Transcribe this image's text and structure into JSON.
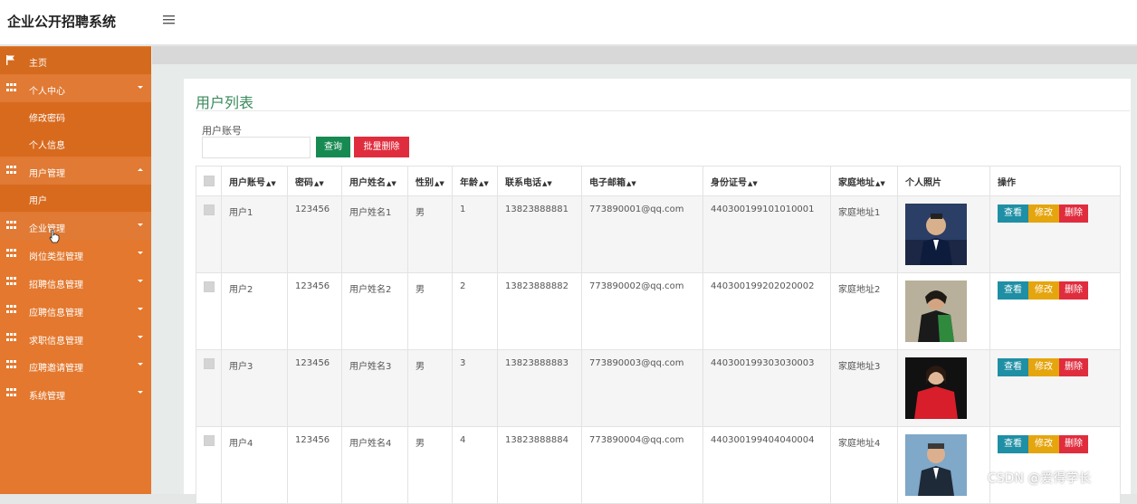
{
  "app": {
    "title": "企业公开招聘系统"
  },
  "sidebar": {
    "items": [
      {
        "label": "主页"
      },
      {
        "label": "个人中心"
      },
      {
        "label": "修改密码"
      },
      {
        "label": "个人信息"
      },
      {
        "label": "用户管理"
      },
      {
        "label": "用户"
      },
      {
        "label": "企业管理"
      },
      {
        "label": "岗位类型管理"
      },
      {
        "label": "招聘信息管理"
      },
      {
        "label": "应聘信息管理"
      },
      {
        "label": "求职信息管理"
      },
      {
        "label": "应聘邀请管理"
      },
      {
        "label": "系统管理"
      }
    ]
  },
  "main": {
    "title": "用户列表",
    "search": {
      "label": "用户账号",
      "value": "",
      "query_button": "查询",
      "batch_delete_button": "批量删除"
    },
    "table": {
      "headers": [
        "用户账号",
        "密码",
        "用户姓名",
        "性别",
        "年龄",
        "联系电话",
        "电子邮箱",
        "身份证号",
        "家庭地址",
        "个人照片",
        "操作"
      ],
      "rows": [
        {
          "account": "用户1",
          "password": "123456",
          "name": "用户姓名1",
          "gender": "男",
          "age": "1",
          "phone": "13823888881",
          "email": "773890001@qq.com",
          "id_card": "440300199101010001",
          "address": "家庭地址1"
        },
        {
          "account": "用户2",
          "password": "123456",
          "name": "用户姓名2",
          "gender": "男",
          "age": "2",
          "phone": "13823888882",
          "email": "773890002@qq.com",
          "id_card": "440300199202020002",
          "address": "家庭地址2"
        },
        {
          "account": "用户3",
          "password": "123456",
          "name": "用户姓名3",
          "gender": "男",
          "age": "3",
          "phone": "13823888883",
          "email": "773890003@qq.com",
          "id_card": "440300199303030003",
          "address": "家庭地址3"
        },
        {
          "account": "用户4",
          "password": "123456",
          "name": "用户姓名4",
          "gender": "男",
          "age": "4",
          "phone": "13823888884",
          "email": "773890004@qq.com",
          "id_card": "440300199404040004",
          "address": "家庭地址4"
        }
      ],
      "actions": {
        "view": "查看",
        "edit": "修改",
        "delete": "删除"
      }
    }
  },
  "watermark": "CSDN @爱得学长",
  "colors": {
    "sidebar": "#e3782e",
    "accent_green": "#178a52",
    "danger": "#e02d3e",
    "info": "#1e8fa4",
    "warning": "#e5a50e"
  }
}
